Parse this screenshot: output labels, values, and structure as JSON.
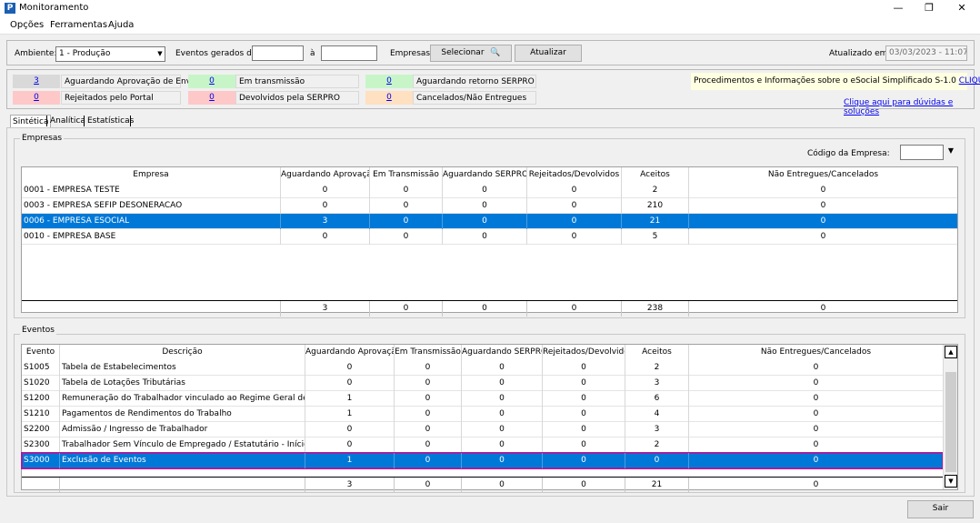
{
  "window": {
    "title": "Monitoramento",
    "minimize": "—",
    "maximize": "❐",
    "close": "✕"
  },
  "menu": {
    "items": [
      "Opções",
      "Ferramentas",
      "Ajuda"
    ]
  },
  "toolbar": {
    "ambiente_label": "Ambiente:",
    "ambiente_value": "1 - Produção",
    "eventos_label": "Eventos gerados de:",
    "date_from": "",
    "a_label": "à",
    "date_to": "",
    "empresas_label": "Empresas:",
    "selecionar_label": "Selecionar",
    "atualizar_label": "Atualizar",
    "atualizado_label": "Atualizado em:",
    "atualizado_value": "03/03/2023 - 11:07"
  },
  "status": {
    "aguardando_envio": {
      "count": "3",
      "label": "Aguardando Aprovação de Envio",
      "color": "#d9d9d9"
    },
    "rejeitados": {
      "count": "0",
      "label": "Rejeitados pelo Portal",
      "color": "#ffc8c8"
    },
    "em_transmissao": {
      "count": "0",
      "label": "Em transmissão",
      "color": "#c8f5c8"
    },
    "devolvidos": {
      "count": "0",
      "label": "Devolvidos pela SERPRO",
      "color": "#ffc8c8"
    },
    "aguardando_retorno": {
      "count": "0",
      "label": "Aguardando retorno SERPRO",
      "color": "#c8f5c8"
    },
    "cancelados": {
      "count": "0",
      "label": "Cancelados/Não Entregues",
      "color": "#ffe0c0"
    }
  },
  "info": {
    "text": "Procedimentos e Informações sobre o eSocial Simplificado S-1.0",
    "link": "CLIQUE AQUI",
    "duvidas_link": "Clique aqui para dúvidas e soluções"
  },
  "tabs": [
    "Sintética",
    "Analítica",
    "Estatísticas"
  ],
  "empresas": {
    "group_title": "Empresas",
    "codigo_label": "Código da Empresa:",
    "codigo_value": "",
    "headers": [
      "Empresa",
      "Aguardando Aprovação",
      "Em Transmissão",
      "Aguardando SERPRO",
      "Rejeitados/Devolvidos",
      "Aceitos",
      "Não Entregues/Cancelados"
    ],
    "rows": [
      [
        "0001 - EMPRESA TESTE",
        "0",
        "0",
        "0",
        "0",
        "2",
        "0"
      ],
      [
        "0003 - EMPRESA SEFIP DESONERACAO",
        "0",
        "0",
        "0",
        "0",
        "210",
        "0"
      ],
      [
        "0006 - EMPRESA ESOCIAL",
        "3",
        "0",
        "0",
        "0",
        "21",
        "0"
      ],
      [
        "0010 - EMPRESA BASE",
        "0",
        "0",
        "0",
        "0",
        "5",
        "0"
      ]
    ],
    "selected_row": 2,
    "totals": [
      "",
      "3",
      "0",
      "0",
      "0",
      "238",
      "0"
    ]
  },
  "eventos": {
    "group_title": "Eventos",
    "headers": [
      "Evento",
      "Descrição",
      "Aguardando Aprovação",
      "Em Transmissão",
      "Aguardando SERPRO",
      "Rejeitados/Devolvidos",
      "Aceitos",
      "Não Entregues/Cancelados"
    ],
    "rows": [
      [
        "S1005",
        "Tabela de Estabelecimentos",
        "0",
        "0",
        "0",
        "0",
        "2",
        "0"
      ],
      [
        "S1020",
        "Tabela de Lotações Tributárias",
        "0",
        "0",
        "0",
        "0",
        "3",
        "0"
      ],
      [
        "S1200",
        "Remuneração do Trabalhador vinculado ao Regime Geral de Previdênci",
        "1",
        "0",
        "0",
        "0",
        "6",
        "0"
      ],
      [
        "S1210",
        "Pagamentos de Rendimentos do Trabalho",
        "1",
        "0",
        "0",
        "0",
        "4",
        "0"
      ],
      [
        "S2200",
        "Admissão / Ingresso de Trabalhador",
        "0",
        "0",
        "0",
        "0",
        "3",
        "0"
      ],
      [
        "S2300",
        "Trabalhador Sem Vínculo de Empregado / Estatutário - Início",
        "0",
        "0",
        "0",
        "0",
        "2",
        "0"
      ],
      [
        "S3000",
        "Exclusão de Eventos",
        "1",
        "0",
        "0",
        "0",
        "0",
        "0"
      ]
    ],
    "selected_row": 6,
    "highlight_color": "#a020a0",
    "totals": [
      "",
      "",
      "3",
      "0",
      "0",
      "0",
      "21",
      "0"
    ]
  },
  "footer": {
    "sair_label": "Sair"
  }
}
